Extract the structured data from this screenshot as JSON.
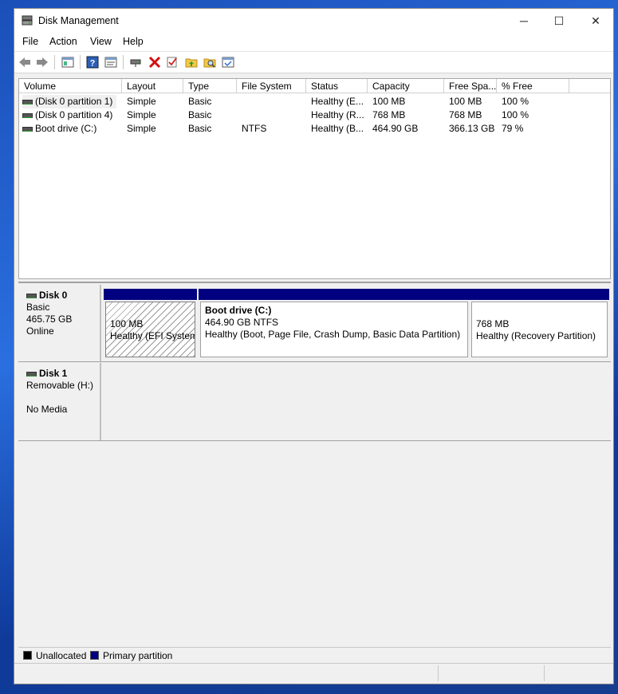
{
  "window": {
    "title": "Disk Management",
    "icon": "disk-management-icon",
    "controls": {
      "minimize": "─",
      "maximize": "☐",
      "close": "✕"
    }
  },
  "menu": [
    "File",
    "Action",
    "View",
    "Help"
  ],
  "toolbar": {
    "icons": [
      "back-icon",
      "forward-icon",
      "show-hide-console-tree-icon",
      "help-icon",
      "properties-icon",
      "connect-drive-icon",
      "delete-icon",
      "check-icon",
      "up-folder-icon",
      "search-folder-icon",
      "rescan-disks-icon"
    ]
  },
  "volume_list": {
    "columns": [
      "Volume",
      "Layout",
      "Type",
      "File System",
      "Status",
      "Capacity",
      "Free Spa...",
      "% Free"
    ],
    "rows": [
      {
        "volume": "(Disk 0 partition 1)",
        "layout": "Simple",
        "type": "Basic",
        "fs": "",
        "status": "Healthy (E...",
        "capacity": "100 MB",
        "free": "100 MB",
        "pct": "100 %"
      },
      {
        "volume": "(Disk 0 partition 4)",
        "layout": "Simple",
        "type": "Basic",
        "fs": "",
        "status": "Healthy (R...",
        "capacity": "768 MB",
        "free": "768 MB",
        "pct": "100 %"
      },
      {
        "volume": "Boot drive (C:)",
        "layout": "Simple",
        "type": "Basic",
        "fs": "NTFS",
        "status": "Healthy (B...",
        "capacity": "464.90 GB",
        "free": "366.13 GB",
        "pct": "79 %"
      }
    ]
  },
  "disks": [
    {
      "name": "Disk 0",
      "type": "Basic",
      "size": "465.75 GB",
      "state": "Online",
      "partitions": [
        {
          "title": "",
          "size": "100 MB",
          "status": "Healthy (EFI System Partition)"
        },
        {
          "title": "Boot drive  (C:)",
          "size": "464.90 GB NTFS",
          "status": "Healthy (Boot, Page File, Crash Dump, Basic Data Partition)"
        },
        {
          "title": "",
          "size": "768 MB",
          "status": "Healthy (Recovery Partition)"
        }
      ]
    },
    {
      "name": "Disk 1",
      "type": "Removable (H:)",
      "size": "",
      "state": "No Media",
      "partitions": []
    }
  ],
  "legend": [
    {
      "label": "Unallocated",
      "color": "#000000"
    },
    {
      "label": "Primary partition",
      "color": "#000080"
    }
  ]
}
